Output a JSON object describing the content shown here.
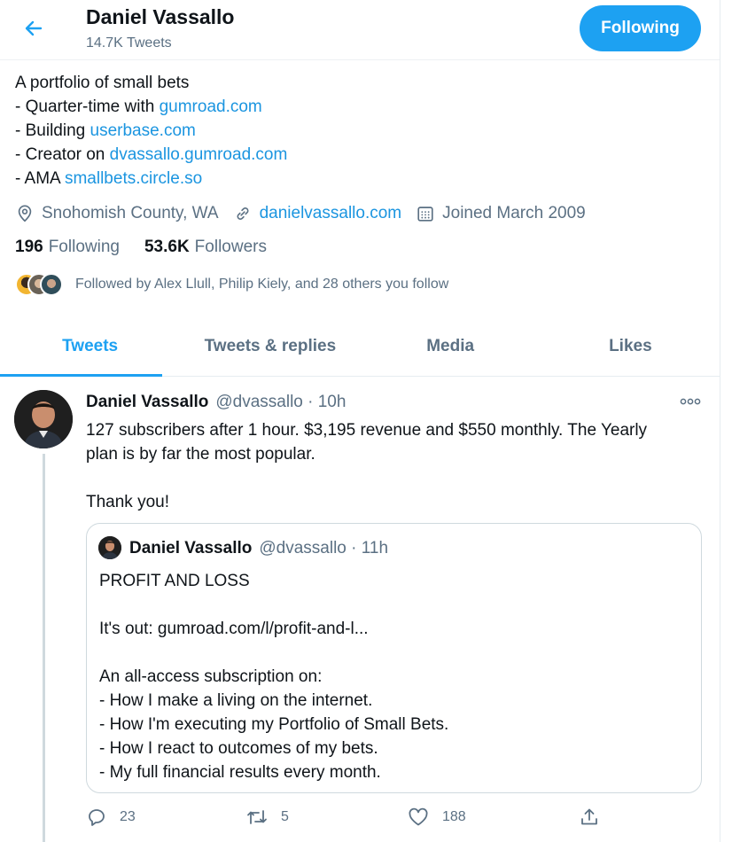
{
  "header": {
    "name": "Daniel Vassallo",
    "tweet_count": "14.7K Tweets",
    "follow_button": "Following"
  },
  "bio": {
    "line1": "A portfolio of small bets",
    "line2_prefix": "- Quarter-time with ",
    "line2_link": "gumroad.com",
    "line3_prefix": "- Building ",
    "line3_link": "userbase.com",
    "line4_prefix": "- Creator on ",
    "line4_link": "dvassallo.gumroad.com",
    "line5_prefix": "- AMA ",
    "line5_link": "smallbets.circle.so"
  },
  "meta": {
    "location": "Snohomish County, WA",
    "website": "danielvassallo.com",
    "joined": "Joined March 2009"
  },
  "stats": {
    "following_count": "196",
    "following_label": "Following",
    "followers_count": "53.6K",
    "followers_label": "Followers"
  },
  "followed_by": "Followed by Alex Llull, Philip Kiely, and 28 others you follow",
  "tabs": [
    {
      "label": "Tweets"
    },
    {
      "label": "Tweets & replies"
    },
    {
      "label": "Media"
    },
    {
      "label": "Likes"
    }
  ],
  "tweet": {
    "name": "Daniel Vassallo",
    "handle_time": "@dvassallo · 10h",
    "text": "127 subscribers after 1 hour. $3,195 revenue and $550 monthly. The Yearly\nplan is by far the most popular.\n\nThank you!",
    "more": "···",
    "replies": "23",
    "retweets": "5",
    "likes": "188"
  },
  "quote": {
    "name": "Daniel Vassallo",
    "handle_time": "@dvassallo · 11h",
    "text": "PROFIT AND LOSS\n\nIt's out: gumroad.com/l/profit-and-l...\n\nAn all-access subscription on:\n- How I make a living on the internet.\n- How I'm executing my Portfolio of Small Bets.\n- How I react to outcomes of my bets.\n- My full financial results every month."
  },
  "colors": {
    "accent": "#1da1f2",
    "link": "#1b95e0",
    "secondary_text": "#5b7083"
  }
}
